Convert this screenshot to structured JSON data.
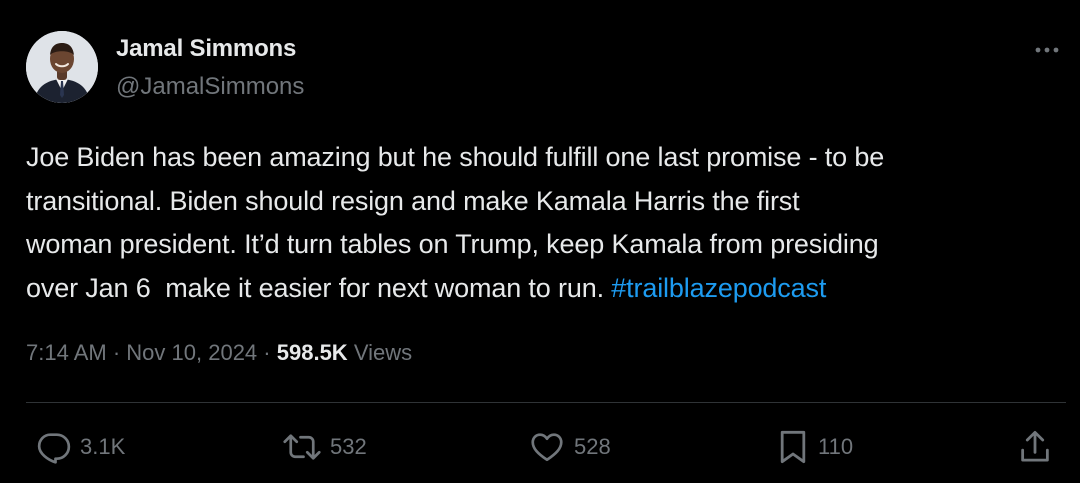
{
  "author": {
    "display_name": "Jamal Simmons",
    "handle": "@JamalSimmons",
    "avatar_icon": "profile-photo"
  },
  "more_icon": "ellipsis-icon",
  "tweet": {
    "lines": [
      "Joe Biden has been amazing but he should fulfill one last promise - to be",
      "transitional. Biden should resign and make Kamala Harris the first",
      "woman president. It’d turn tables on Trump, keep Kamala from presiding",
      "over Jan 6  make it easier for next woman to run. "
    ],
    "hashtag": "#trailblazepodcast"
  },
  "meta": {
    "time": "7:14 AM",
    "separator": "·",
    "date": "Nov 10, 2024",
    "views_count": "598.5K",
    "views_label": "Views"
  },
  "actions": {
    "reply": {
      "icon": "reply-icon",
      "count": "3.1K"
    },
    "repost": {
      "icon": "repost-icon",
      "count": "532"
    },
    "like": {
      "icon": "heart-icon",
      "count": "528"
    },
    "bookmark": {
      "icon": "bookmark-icon",
      "count": "110"
    },
    "share": {
      "icon": "share-icon"
    }
  },
  "colors": {
    "background": "#000000",
    "text_primary": "#e7e9ea",
    "text_secondary": "#71767b",
    "link": "#1d9bf0",
    "divider": "#2f3336"
  }
}
